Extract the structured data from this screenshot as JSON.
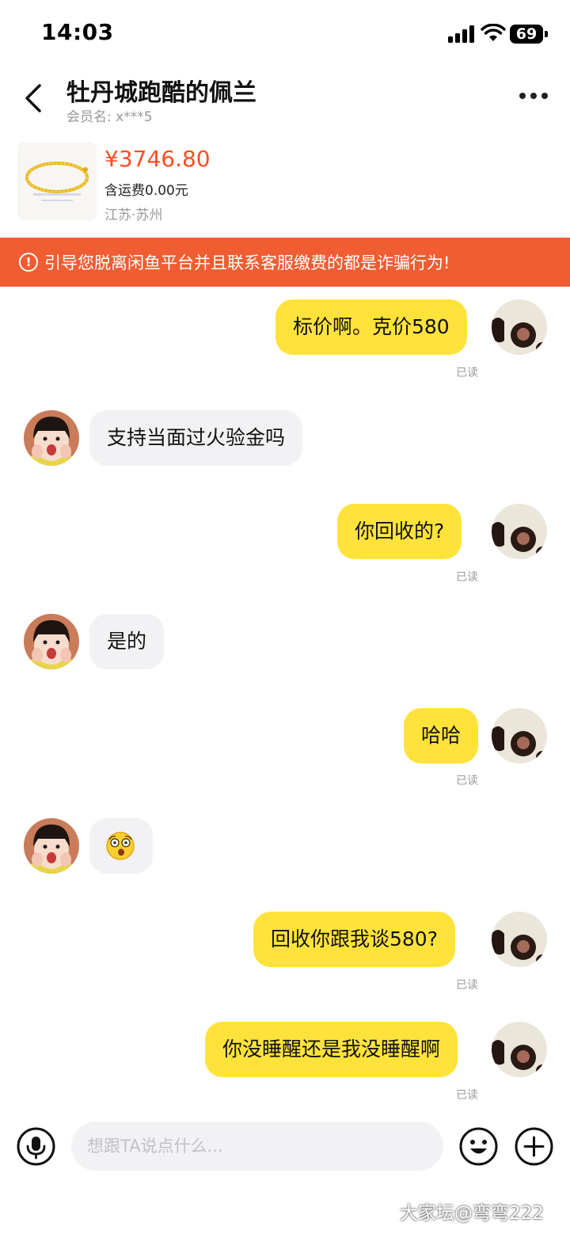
{
  "status_bar": {
    "time": "14:03",
    "battery": "69"
  },
  "header": {
    "title": "牡丹城跑酷的佩兰",
    "member_label": "会员名:",
    "member_name": "x***5"
  },
  "product": {
    "price": "¥3746.80",
    "shipping": "含运费0.00元",
    "location": "江苏·苏州"
  },
  "warning": {
    "icon": "!",
    "text": "引导您脱离闲鱼平台并且联系客服缴费的都是诈骗行为!"
  },
  "messages": [
    {
      "sender": "me",
      "text": "标价啊。克价580",
      "status": "已读"
    },
    {
      "sender": "them",
      "text": "支持当面过火验金吗"
    },
    {
      "sender": "me",
      "text": "你回收的?",
      "status": "已读"
    },
    {
      "sender": "them",
      "text": "是的"
    },
    {
      "sender": "me",
      "text": "哈哈",
      "status": "已读"
    },
    {
      "sender": "them",
      "text": "",
      "emoji": "shocked-face"
    },
    {
      "sender": "me",
      "text": "回收你跟我谈580?",
      "status": "已读"
    },
    {
      "sender": "me",
      "text": "你没睡醒还是我没睡醒啊",
      "status": "已读"
    }
  ],
  "input": {
    "placeholder": "想跟TA说点什么..."
  },
  "watermark": "大家坛@弯弯222",
  "colors": {
    "accent": "#ffe33b",
    "warning": "#f05d32",
    "price": "#ff4d23"
  }
}
